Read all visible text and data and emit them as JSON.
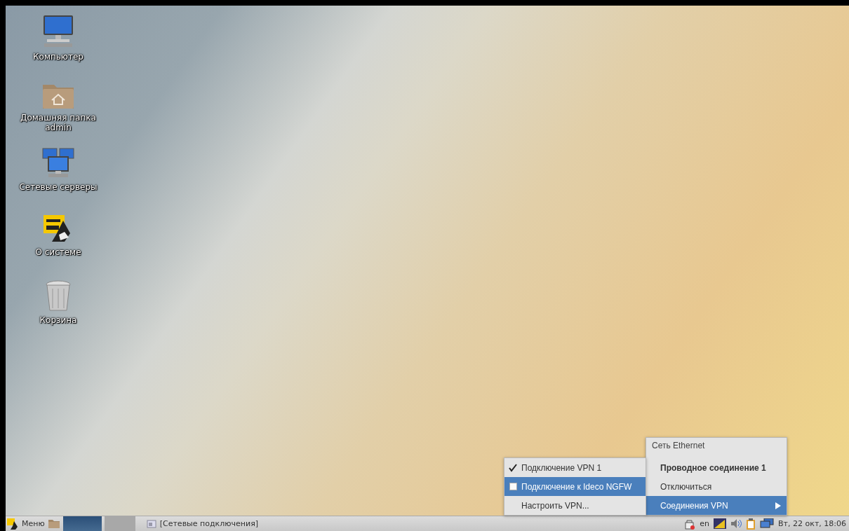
{
  "desktop_icons": [
    {
      "label": "Компьютер",
      "kind": "computer"
    },
    {
      "label": "Домашняя папка admin",
      "kind": "home"
    },
    {
      "label": "Сетевые серверы",
      "kind": "network"
    },
    {
      "label": "О системе",
      "kind": "about"
    },
    {
      "label": "Корзина",
      "kind": "trash"
    }
  ],
  "network_menu": {
    "header": "Сеть Ethernet",
    "items": [
      {
        "label": "Проводное соединение 1",
        "kind": "connection",
        "selected": false
      },
      {
        "label": "Отключиться",
        "kind": "action",
        "selected": false
      },
      {
        "label": "Соединения VPN",
        "kind": "submenu",
        "selected": true
      }
    ]
  },
  "vpn_submenu": {
    "items": [
      {
        "label": "Подключение VPN 1",
        "kind": "check",
        "checked": true,
        "selected": false
      },
      {
        "label": "Подключение к Ideco NGFW",
        "kind": "check",
        "checked": false,
        "selected": true
      },
      {
        "label": "Настроить VPN...",
        "kind": "action",
        "selected": false
      }
    ]
  },
  "taskbar": {
    "menu_button": "Меню",
    "task": "[Сетевые подключения]",
    "keyboard_layout": "en",
    "clock": "Вт, 22 окт, 18:06"
  }
}
